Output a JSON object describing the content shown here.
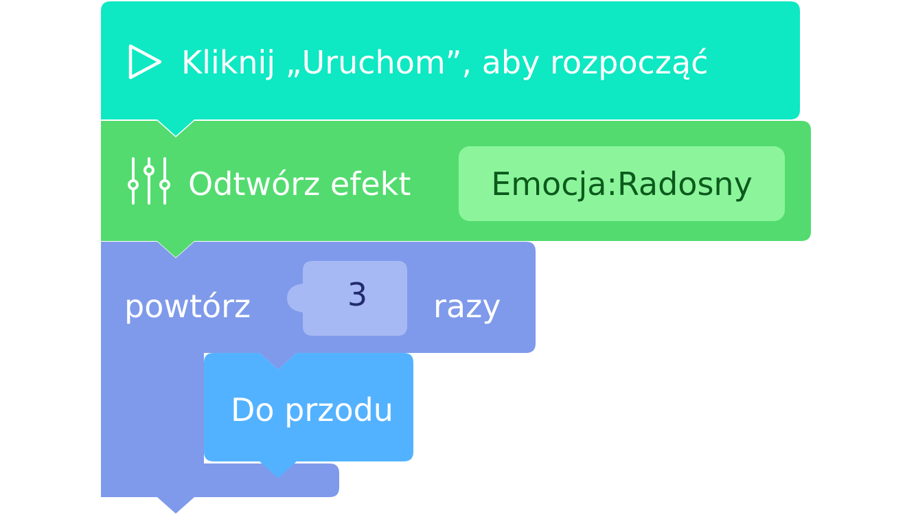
{
  "blocks": {
    "start": {
      "label": "Kliknij „Uruchom”, aby rozpocząć",
      "icon": "play-icon",
      "color": "#0ee8c3"
    },
    "play_effect": {
      "label": "Odtwórz efekt",
      "icon": "sliders-icon",
      "value": "Emocja:Radosny",
      "color": "#53db6f",
      "value_color": "#8cf59c"
    },
    "repeat": {
      "prefix": "powtórz",
      "count": "3",
      "suffix": "razy",
      "color": "#7f9aea",
      "slot_color": "#a6b9f4"
    },
    "forward": {
      "label": "Do przodu",
      "color": "#53b2ff"
    }
  }
}
